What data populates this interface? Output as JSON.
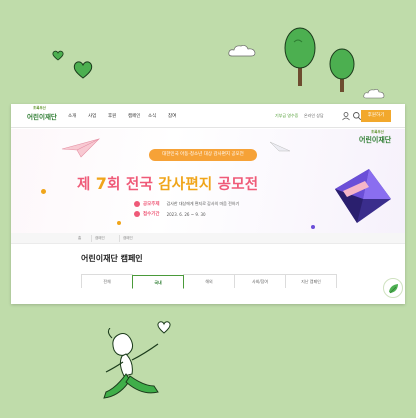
{
  "colors": {
    "background": "#bfdcaa",
    "accent_pink": "#ef5a78",
    "accent_orange": "#f0a51a",
    "brand_green": "#2e7d32",
    "donate_orange": "#f2a82c"
  },
  "nav": {
    "logo_sub": "초록우산",
    "logo": "어린이재단",
    "menu": [
      "소개",
      "사업",
      "후원",
      "캠페인",
      "소식",
      "참여"
    ],
    "util_links": [
      "기부금 영수증",
      "온라인 상담"
    ],
    "icons": [
      "user-icon",
      "search-icon"
    ],
    "donate_label": "후원하기"
  },
  "hero": {
    "logo_sub": "초록우산",
    "logo": "어린이재단",
    "pill": "대한민국 아동·청소년 대상 감사편지 공모전",
    "title_prefix": "제 ",
    "title_num": "7",
    "title_mid": "회 전국 ",
    "title_highlight": "감사편지",
    "title_suffix": " 공모전",
    "info": [
      {
        "key": "공모주제",
        "value": "감사한 대상에게 편지로 감사의 마음 전하기"
      },
      {
        "key": "접수기간",
        "value": "2023. 6. 26 ~ 9. 30"
      }
    ]
  },
  "breadcrumb": [
    "홈",
    "캠페인",
    "캠페인"
  ],
  "section": {
    "title": "어린이재단 캠페인"
  },
  "tabs": [
    "전체",
    "국내",
    "해외",
    "사회/참여",
    "지난 캠페인"
  ],
  "active_tab": "국내"
}
